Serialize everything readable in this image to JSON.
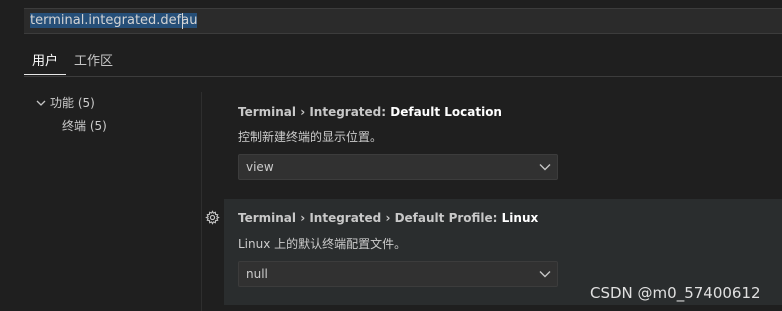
{
  "search": {
    "value": "terminal.integrated.defau"
  },
  "tabs": [
    {
      "label": "用户",
      "active": true
    },
    {
      "label": "工作区",
      "active": false
    }
  ],
  "tree": {
    "group": {
      "label": "功能 (5)",
      "icon": "chevron-down-icon"
    },
    "children": [
      {
        "label": "终端 (5)"
      }
    ]
  },
  "settings": [
    {
      "category": "Terminal › Integrated: ",
      "key": "Default Location",
      "description": "控制新建终端的显示位置。",
      "value": "view"
    },
    {
      "category": "Terminal › Integrated › Default Profile: ",
      "key": "Linux",
      "description": "Linux 上的默认终端配置文件。",
      "value": "null",
      "icon": "gear-icon"
    }
  ],
  "watermark": "CSDN @m0_57400612",
  "colors": {
    "background": "#1f1f1f",
    "hover_row": "#2a2d2e",
    "selection": "#264f78"
  }
}
